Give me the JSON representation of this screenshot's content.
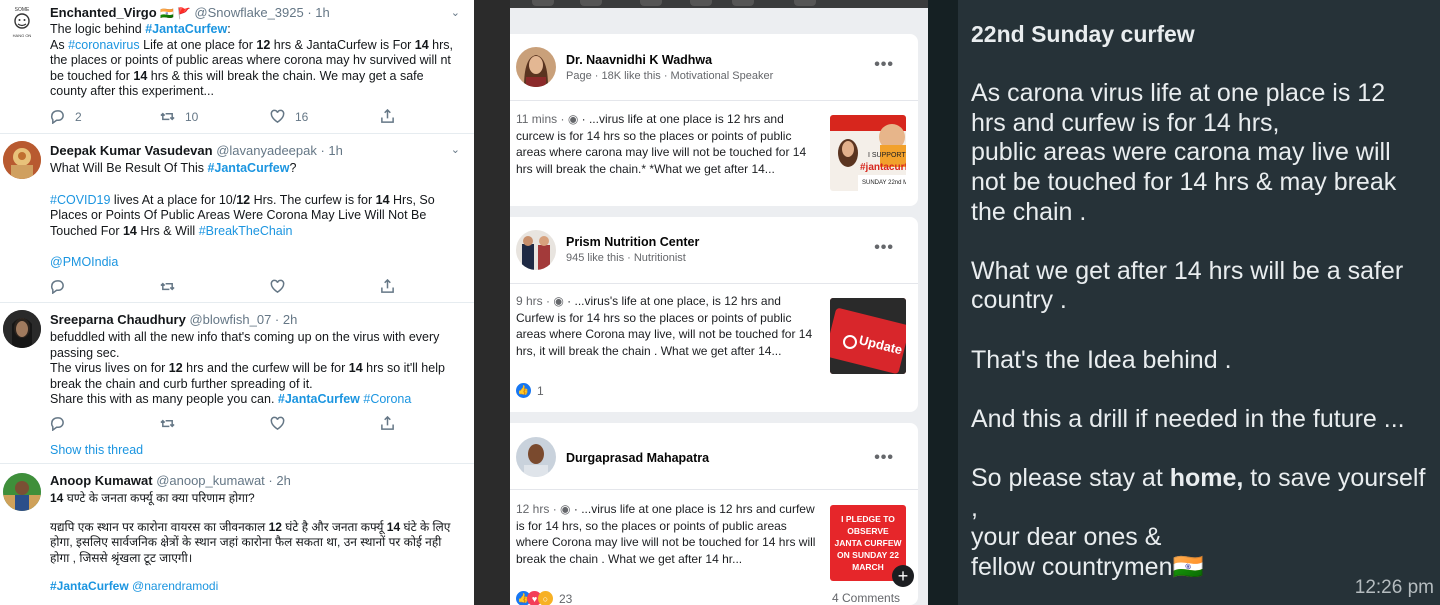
{
  "twitter": {
    "tweets": [
      {
        "name": "Enchanted_Virgo",
        "flags": "🇮🇳 🚩",
        "handle": "@Snowflake_3925",
        "time": "1h",
        "lines": [
          [
            "The logic behind ",
            "#JantaCurfew",
            ":"
          ],
          [
            "As ",
            "#coronavirus",
            " Life at one place for ",
            "12",
            " hrs & JantaCurfew is For ",
            "14",
            " hrs,"
          ],
          [
            "the places or points of public areas where corona may hv survived will nt"
          ],
          [
            "be touched for ",
            "14",
            " hrs & this will break the chain. We may get a safe"
          ],
          [
            "county after this experiment..."
          ]
        ],
        "replies": "2",
        "retweets": "10",
        "likes": "16"
      },
      {
        "name": "Deepak Kumar Vasudevan",
        "handle": "@lavanyadeepak",
        "time": "1h",
        "l1a": "What Will Be Result Of This ",
        "l1b": "#JantaCurfew",
        "l1c": "?",
        "l2a": "#COVID19",
        "l2b": " lives At a place for 10/",
        "l2c": "12",
        "l2d": " Hrs. The curfew is for ",
        "l2e": "14",
        "l2f": " Hrs, So",
        "l3": "Places or Points Of Public Areas Were  Corona May Live Will Not Be",
        "l4a": "Touched For ",
        "l4b": "14",
        "l4c": " Hrs & Will ",
        "l4d": "#BreakTheChain",
        "l5": "@PMOIndia"
      },
      {
        "name": "Sreeparna Chaudhury",
        "handle": "@blowfish_07",
        "time": "2h",
        "l1": "befuddled with all the new info that's coming up on the virus with every",
        "l2": "passing sec.",
        "l3a": "The virus lives on for ",
        "l3b": "12",
        "l3c": " hrs and the curfew will be for ",
        "l3d": "14",
        "l3e": " hrs so it'll help",
        "l4": "break the chain and curb further spreading of it.",
        "l5a": "Share this with as many people you can. ",
        "l5b": "#JantaCurfew",
        "l5c": " #Corona",
        "thread": "Show this thread"
      },
      {
        "name": "Anoop Kumawat",
        "handle": "@anoop_kumawat",
        "time": "2h",
        "l1a": "14",
        "l1b": " घण्टे के जनता कर्फ्यू का क्या परिणाम होगा?",
        "l2a": "यद्यपि एक स्थान पर कारोना वायरस का जीवनकाल ",
        "l2b": "12",
        "l2c": " घंटे है और जनता कर्फ्यू ",
        "l2d": "14",
        "l2e": " घंटे के लिए",
        "l3": "होगा, इसलिए सार्वजनिक क्षेत्रों के स्थान जहां कारोना फैल सकता था, उन स्थानों पर कोई नही",
        "l4": "होगा , जिससे श्रृंखला टूट जाएगी।",
        "l5a": "#JantaCurfew",
        "l5b": " @narendramodi"
      }
    ]
  },
  "facebook": {
    "posts": [
      {
        "name": "Dr. Naavnidhi K Wadhwa",
        "sub": "Page · 18K like this · Motivational Speaker",
        "time": "11 mins",
        "snippet": " ...virus life at one place is 12 hrs and curcew is for 14 hrs so the places or points of public areas where carona may live will not be touched for 14 hrs will break the chain.* *What we get after 14...",
        "thumb_text": "I SUPPORT #jantacurf SUNDAY 22nd MA"
      },
      {
        "name": "Prism Nutrition Center",
        "sub": "945 like this · Nutritionist",
        "time": "9 hrs",
        "snippet": " ...virus's life at one place, is 12 hrs and Curfew is for 14 hrs so the places or points of public areas where Corona may live, will not be touched for 14 hrs, it will break the chain . What we get after 14...",
        "thumb_text": "Update",
        "reactions": "1"
      },
      {
        "name": "Durgaprasad Mahapatra",
        "time": "12 hrs",
        "snippet": " ...virus life at one place is 12 hrs and curfew is for 14 hrs, so the places or points of public areas where Corona may live will not be touched for 14 hrs will break the chain . What we get after 14 hr...",
        "thumb_text": "I PLEDGE TO OBSERVE JANTA CURFEW ON SUNDAY 22 MARCH",
        "reactions": "23",
        "comments": "4 Comments"
      }
    ]
  },
  "whatsapp": {
    "title": "22nd Sunday curfew",
    "p1": "As carona virus life at one place is 12 hrs and curfew  is for 14 hrs,",
    "p2": " public areas were  carona may live will not be touched for 14 hrs & may break the chain .",
    "p3": "What we get  after 14 hrs will be a safer country .",
    "p4": "That's the Idea behind .",
    "p5": "And this  a drill if needed in the future ...",
    "p6a": "So please stay at ",
    "p6b": "home,",
    "p6c": " to save yourself ,",
    "p7": " your dear ones &",
    "p8": "fellow countrymen🇮🇳",
    "time": "12:26 pm"
  }
}
